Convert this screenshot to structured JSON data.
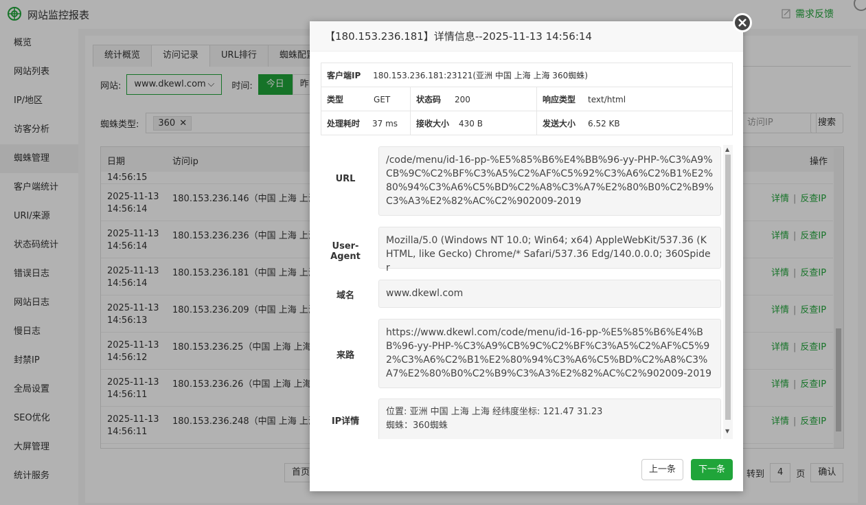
{
  "app": {
    "title": "网站监控报表",
    "feedback": "需求反馈"
  },
  "sidebar": {
    "items": [
      {
        "label": "概览"
      },
      {
        "label": "网站列表"
      },
      {
        "label": "IP/地区"
      },
      {
        "label": "访客分析"
      },
      {
        "label": "蜘蛛管理",
        "active": true
      },
      {
        "label": "客户端统计"
      },
      {
        "label": "URI/来源"
      },
      {
        "label": "状态码统计"
      },
      {
        "label": "错误日志"
      },
      {
        "label": "网站日志"
      },
      {
        "label": "慢日志"
      },
      {
        "label": "封禁IP"
      },
      {
        "label": "全局设置"
      },
      {
        "label": "SEO优化"
      },
      {
        "label": "大屏管理"
      },
      {
        "label": "统计服务"
      }
    ]
  },
  "tabs": [
    "统计概览",
    "访问记录",
    "URL排行",
    "蜘蛛配置"
  ],
  "filters": {
    "site_label": "网站:",
    "site_value": "www.dkewl.com",
    "time_label": "时间:",
    "today": "今日",
    "yesterday_partial": "昨",
    "spider_label": "蜘蛛类型:",
    "spider_tag": "360",
    "ip_placeholder": "访问IP",
    "search": "搜索"
  },
  "table": {
    "headers": {
      "date": "日期",
      "ip": "访问ip",
      "ops": "操作"
    },
    "partial_time": "14:56:15",
    "rows": [
      {
        "date": "2025-11-13",
        "time": "14:56:14",
        "ip": "180.153.236.146（中国 上海 上海）"
      },
      {
        "date": "2025-11-13",
        "time": "14:56:14",
        "ip": "180.153.236.236（中国 上海 上海）"
      },
      {
        "date": "2025-11-13",
        "time": "14:56:14",
        "ip": "180.153.236.181（中国 上海 上海）"
      },
      {
        "date": "2025-11-13",
        "time": "14:56:13",
        "ip": "180.153.236.209（中国 上海 上海）"
      },
      {
        "date": "2025-11-13",
        "time": "14:56:12",
        "ip": "180.153.236.25（中国 上海 上海）"
      },
      {
        "date": "2025-11-13",
        "time": "14:56:11",
        "ip": "180.153.236.26（中国 上海 上海）"
      },
      {
        "date": "2025-11-13",
        "time": "14:56:11",
        "ip": "180.153.236.248（中国 上海 上海）"
      }
    ],
    "op_detail": "详情",
    "op_sep": "|",
    "op_reverse": "反查IP"
  },
  "pager": {
    "first": "首页",
    "goto": "转到",
    "page_num": "4",
    "page_unit": "页",
    "confirm": "确认"
  },
  "modal": {
    "title": "【180.153.236.181】详情信息--2025-11-13 14:56:14",
    "client_ip_label": "客户端IP",
    "client_ip_value": "180.153.236.181:23121(亚洲 中国 上海 上海 360蜘蛛)",
    "type_label": "类型",
    "type_value": "GET",
    "status_label": "状态码",
    "status_value": "200",
    "resp_type_label": "响应类型",
    "resp_type_value": "text/html",
    "time_label": "处理耗时",
    "time_value": "37 ms",
    "recv_label": "接收大小",
    "recv_value": "430 B",
    "send_label": "发送大小",
    "send_value": "6.52 KB",
    "url_label": "URL",
    "url_value": "/code/menu/id-16-pp-%E5%85%B6%E4%BB%96-yy-PHP-%C3%A9%CB%9C%C2%BF%C3%A5%C2%AF%C5%92%C3%A6%C2%B1%E2%80%94%C3%A6%C5%BD%C2%A8%C3%A7%E2%80%B0%C2%B9%C3%A3%E2%82%AC%C2%902009-2019",
    "ua_label": "User-Agent",
    "ua_value": "Mozilla/5.0 (Windows NT 10.0; Win64; x64) AppleWebKit/537.36 (KHTML, like Gecko) Chrome/* Safari/537.36 Edg/140.0.0.0; 360Spider",
    "domain_label": "域名",
    "domain_value": "www.dkewl.com",
    "referer_label": "来路",
    "referer_value": "https://www.dkewl.com/code/menu/id-16-pp-%E5%85%B6%E4%BB%96-yy-PHP-%C3%A9%CB%9C%C2%BF%C3%A5%C2%AF%C5%92%C3%A6%C2%B1%E2%80%94%C3%A6%C5%BD%C2%A8%C3%A7%E2%80%B0%C2%B9%C3%A3%E2%82%AC%C2%902009-2019",
    "ipinfo_label": "IP详情",
    "ipinfo_line1": "位置: 亚洲 中国 上海 上海 经纬度坐标: 121.47 31.23",
    "ipinfo_line2": "蜘蛛：360蜘蛛",
    "prev": "上一条",
    "next": "下一条"
  },
  "colors": {
    "accent": "#20a53a"
  }
}
